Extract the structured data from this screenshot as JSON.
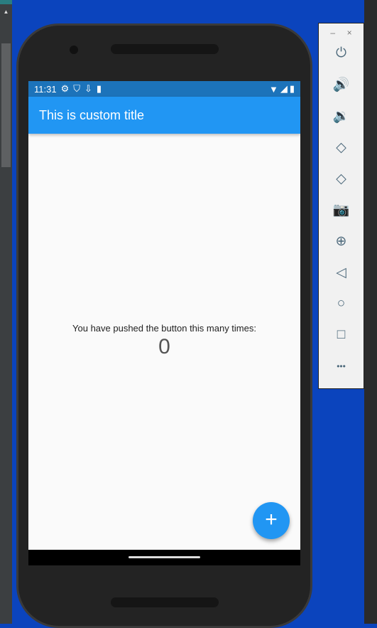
{
  "status_bar": {
    "time": "11:31"
  },
  "app_bar": {
    "title": "This is custom title"
  },
  "body": {
    "message": "You have pushed the button this many times:",
    "counter": "0"
  },
  "fab": {
    "label": "+"
  },
  "emulator_panel": {
    "minimize": "–",
    "close": "×",
    "buttons": [
      {
        "name": "power",
        "glyph": "⏻"
      },
      {
        "name": "volume-up",
        "glyph": "🔊"
      },
      {
        "name": "volume-down",
        "glyph": "🔉"
      },
      {
        "name": "rotate-left",
        "glyph": "◇"
      },
      {
        "name": "rotate-right",
        "glyph": "◇"
      },
      {
        "name": "screenshot",
        "glyph": "📷"
      },
      {
        "name": "zoom",
        "glyph": "⊕"
      },
      {
        "name": "back",
        "glyph": "◁"
      },
      {
        "name": "home",
        "glyph": "○"
      },
      {
        "name": "overview",
        "glyph": "□"
      },
      {
        "name": "more",
        "glyph": "•••"
      }
    ]
  },
  "colors": {
    "primary": "#2196f3",
    "status": "#1c73ba"
  }
}
